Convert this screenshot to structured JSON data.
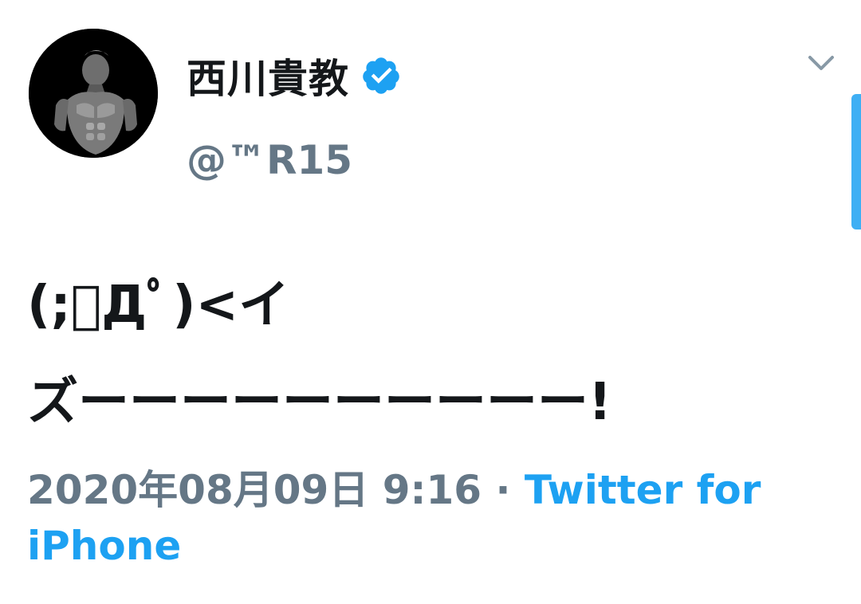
{
  "tweet": {
    "display_name": "西川貴教",
    "verified": true,
    "handle": "@™R15",
    "text": "(;ﾟДﾟ)<イ\nズーーーーーーーーーー!",
    "timestamp": "2020年08月09日 9:16",
    "separator": " · ",
    "source": "Twitter for iPhone"
  },
  "icons": {
    "verified": "verified-badge-icon",
    "chevron": "chevron-down-icon",
    "avatar": "profile-avatar"
  },
  "colors": {
    "accent": "#1da1f2",
    "text_primary": "#14171a",
    "text_secondary": "#657786",
    "chevron": "#8899a6"
  }
}
